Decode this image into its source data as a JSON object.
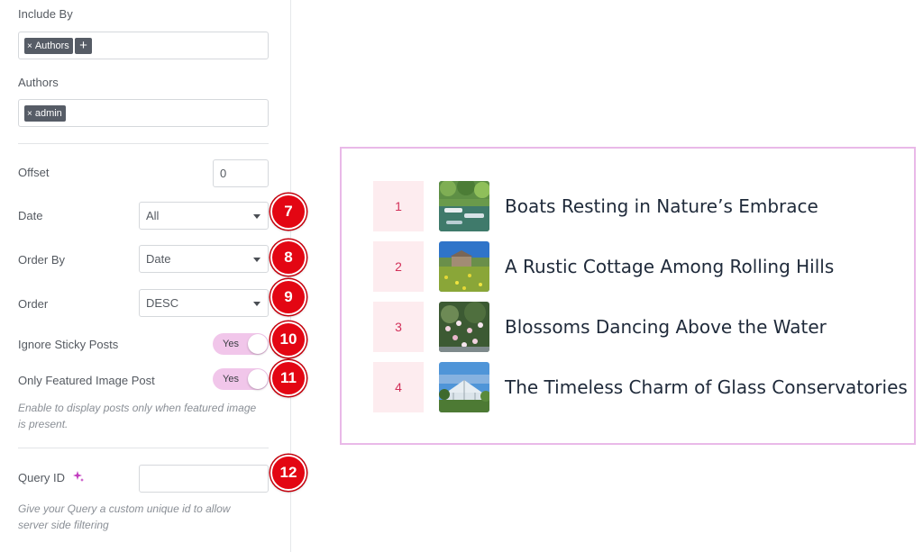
{
  "panel": {
    "include_by": {
      "label": "Include By",
      "tags": [
        "Authors"
      ]
    },
    "authors": {
      "label": "Authors",
      "tags": [
        "admin"
      ]
    },
    "offset": {
      "label": "Offset",
      "value": "0"
    },
    "date": {
      "label": "Date",
      "selected": "All",
      "badge": "7"
    },
    "order_by": {
      "label": "Order By",
      "selected": "Date",
      "badge": "8"
    },
    "order": {
      "label": "Order",
      "selected": "DESC",
      "badge": "9"
    },
    "ignore_sticky": {
      "label": "Ignore Sticky Posts",
      "toggle": "Yes",
      "badge": "10"
    },
    "featured_only": {
      "label": "Only Featured Image Post",
      "toggle": "Yes",
      "badge": "11",
      "hint": "Enable to display posts only when featured image is present."
    },
    "query_id": {
      "label": "Query ID",
      "value": "",
      "badge": "12",
      "hint": "Give your Query a custom unique id to allow server side filtering"
    }
  },
  "preview": {
    "posts": [
      {
        "number": "1",
        "title": "Boats Resting in Nature’s Embrace",
        "thumb": "boats-in-pond"
      },
      {
        "number": "2",
        "title": "A Rustic Cottage Among Rolling Hills",
        "thumb": "cottage-meadow"
      },
      {
        "number": "3",
        "title": "Blossoms Dancing Above the Water",
        "thumb": "blossom-tree"
      },
      {
        "number": "4",
        "title": "The Timeless Charm of Glass Conservatories",
        "thumb": "glasshouse"
      }
    ]
  },
  "colors": {
    "badge": "#e30613",
    "toggle_on": "#f1c6ea",
    "preview_border": "#e9b9e8",
    "number_bg": "#fdecef",
    "number_text": "#d2315a",
    "tag_bg": "#565c66"
  },
  "icons": {
    "tag_remove": "×",
    "tag_add": "+",
    "query_id_ai": "sparkle-icon"
  }
}
